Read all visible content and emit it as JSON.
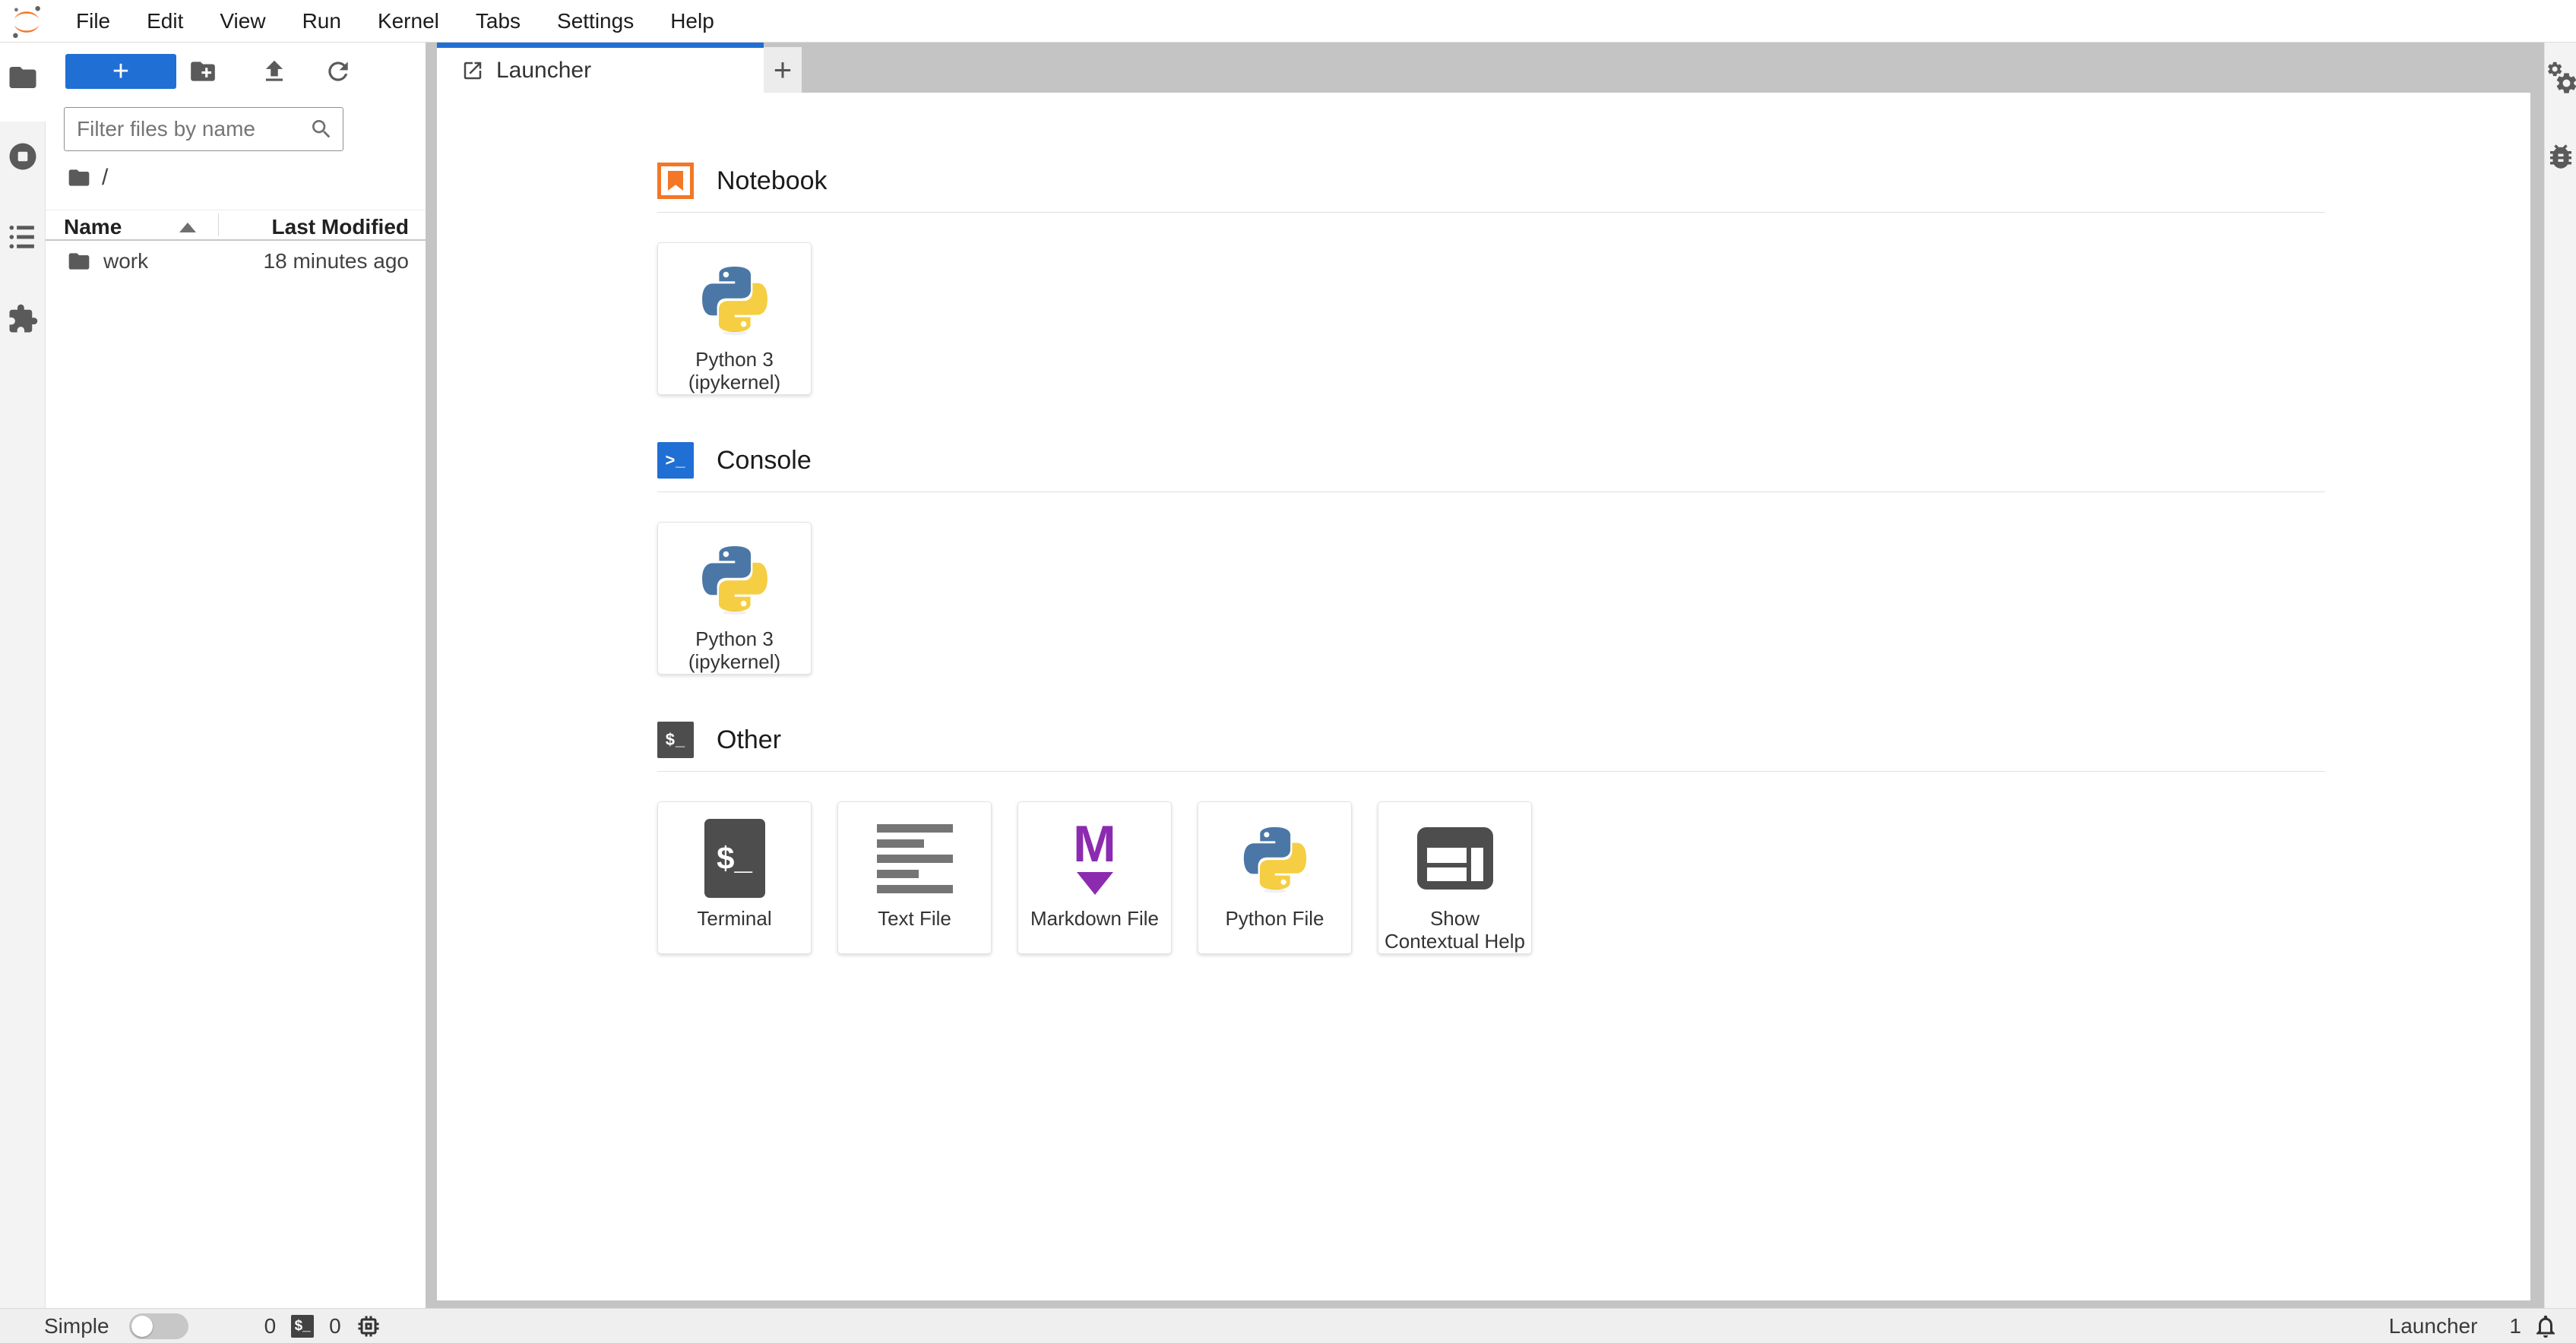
{
  "menu_bar": {
    "items": [
      "File",
      "Edit",
      "View",
      "Run",
      "Kernel",
      "Tabs",
      "Settings",
      "Help"
    ]
  },
  "file_browser": {
    "new_launcher_label": "+",
    "filter_placeholder": "Filter files by name",
    "breadcrumb_root": "/",
    "header": {
      "name": "Name",
      "modified": "Last Modified"
    },
    "rows": [
      {
        "name": "work",
        "modified": "18 minutes ago"
      }
    ]
  },
  "main_area": {
    "tab_label": "Launcher",
    "new_tab_label": "+"
  },
  "launcher": {
    "sections": [
      {
        "title": "Notebook",
        "cards": [
          {
            "line1": "Python 3",
            "line2": "(ipykernel)"
          }
        ]
      },
      {
        "title": "Console",
        "cards": [
          {
            "line1": "Python 3",
            "line2": "(ipykernel)"
          }
        ]
      },
      {
        "title": "Other",
        "cards": [
          {
            "line1": "Terminal",
            "line2": ""
          },
          {
            "line1": "Text File",
            "line2": ""
          },
          {
            "line1": "Markdown File",
            "line2": ""
          },
          {
            "line1": "Python File",
            "line2": ""
          },
          {
            "line1": "Show",
            "line2": "Contextual Help"
          }
        ]
      }
    ]
  },
  "icons": {
    "console_glyph": ">_",
    "other_glyph": "$_",
    "terminal_glyph": "$_",
    "terminal_badge_glyph": "$_",
    "markdown_glyph": "M"
  },
  "status_bar": {
    "mode_label": "Simple",
    "terminal_count": "0",
    "kernel_count": "0",
    "context_label": "Launcher",
    "notification_count": "1"
  },
  "colors": {
    "accent_blue": "#1f6fd4",
    "jupyter_orange": "#f37726",
    "markdown_purple": "#8c2bb0"
  }
}
